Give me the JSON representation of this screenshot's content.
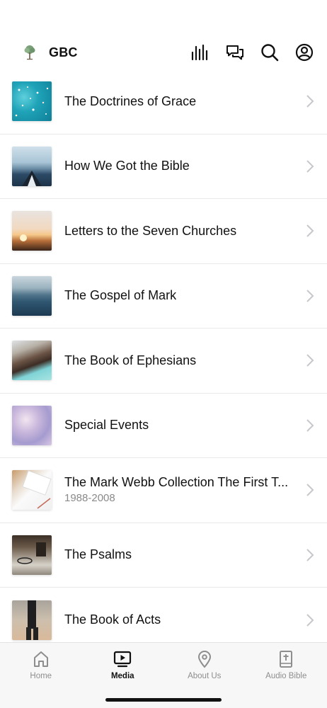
{
  "header": {
    "brand_name": "GBC"
  },
  "icons": {
    "logo": "tree-logo-icon",
    "actions": [
      "audio-bars-icon",
      "chat-bubbles-icon",
      "search-icon",
      "profile-icon"
    ]
  },
  "list": {
    "items": [
      {
        "title": "The Doctrines of Grace",
        "subtitle": ""
      },
      {
        "title": "How We Got the Bible",
        "subtitle": ""
      },
      {
        "title": "Letters to the Seven Churches",
        "subtitle": ""
      },
      {
        "title": "The Gospel of Mark",
        "subtitle": ""
      },
      {
        "title": "The Book of Ephesians",
        "subtitle": ""
      },
      {
        "title": "Special Events",
        "subtitle": ""
      },
      {
        "title": "The Mark Webb Collection The First T...",
        "subtitle": "1988-2008"
      },
      {
        "title": "The Psalms",
        "subtitle": ""
      },
      {
        "title": "The Book of Acts",
        "subtitle": ""
      }
    ]
  },
  "tabbar": {
    "tabs": [
      {
        "label": "Home",
        "icon": "home-icon",
        "active": false
      },
      {
        "label": "Media",
        "icon": "media-icon",
        "active": true
      },
      {
        "label": "About Us",
        "icon": "location-pin-icon",
        "active": false
      },
      {
        "label": "Audio Bible",
        "icon": "bible-icon",
        "active": false
      }
    ]
  },
  "colors": {
    "active_tab": "#111111",
    "inactive_tab": "#8e8e8e",
    "divider": "#e9e9e9"
  }
}
